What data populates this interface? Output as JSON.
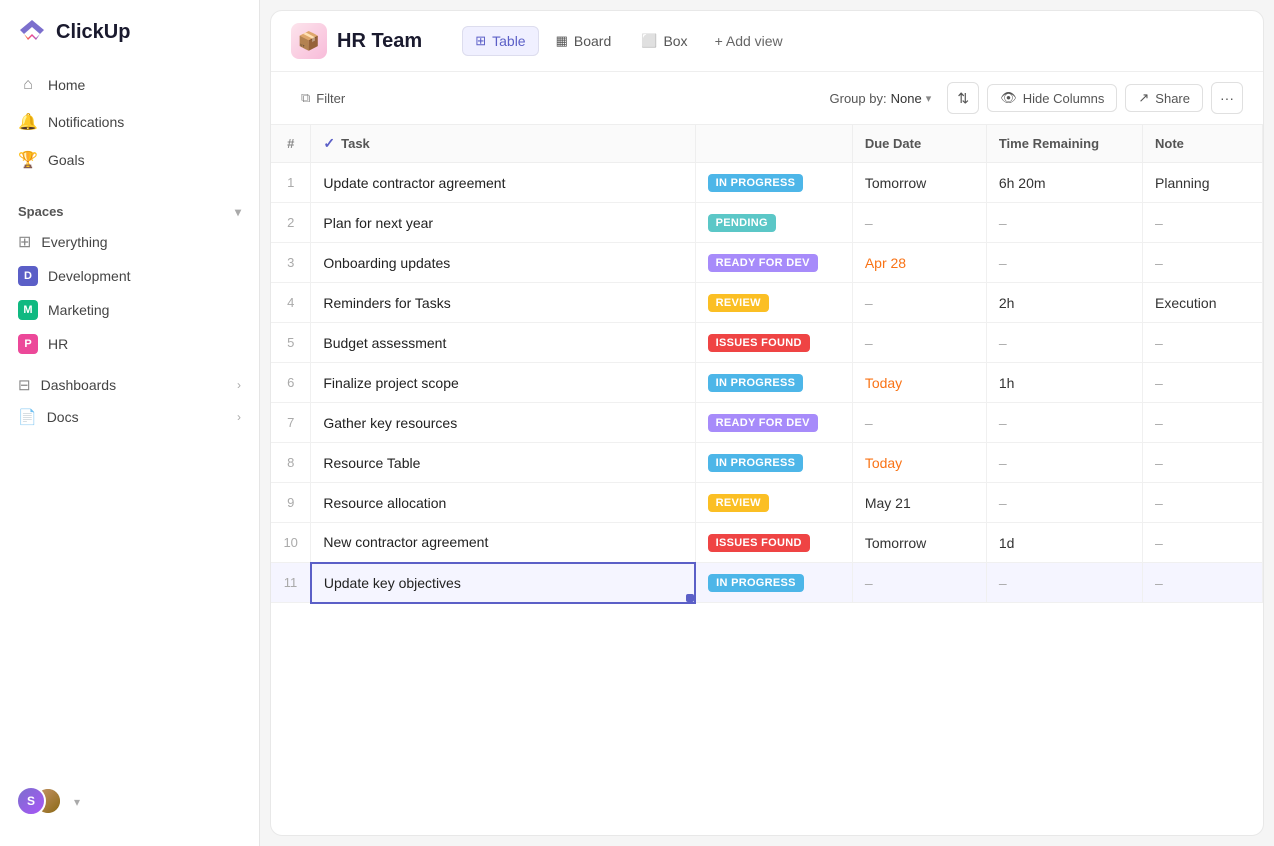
{
  "app": {
    "name": "ClickUp"
  },
  "sidebar": {
    "nav": [
      {
        "id": "home",
        "label": "Home",
        "icon": "⌂"
      },
      {
        "id": "notifications",
        "label": "Notifications",
        "icon": "🔔"
      },
      {
        "id": "goals",
        "label": "Goals",
        "icon": "🏆"
      }
    ],
    "spaces_label": "Spaces",
    "everything_label": "Everything",
    "spaces": [
      {
        "id": "development",
        "label": "Development",
        "initial": "D",
        "color": "#5b5fc7"
      },
      {
        "id": "marketing",
        "label": "Marketing",
        "initial": "M",
        "color": "#10b981"
      },
      {
        "id": "hr",
        "label": "HR",
        "initial": "P",
        "color": "#ec4899"
      }
    ],
    "dashboards_label": "Dashboards",
    "docs_label": "Docs"
  },
  "header": {
    "space_name": "HR Team",
    "views": [
      {
        "id": "table",
        "label": "Table",
        "active": true
      },
      {
        "id": "board",
        "label": "Board",
        "active": false
      },
      {
        "id": "box",
        "label": "Box",
        "active": false
      }
    ],
    "add_view_label": "+ Add view"
  },
  "toolbar": {
    "filter_label": "Filter",
    "groupby_label": "Group by:",
    "groupby_value": "None",
    "hide_columns_label": "Hide Columns",
    "share_label": "Share"
  },
  "table": {
    "columns": [
      "#",
      "Task",
      "",
      "Due Date",
      "Time Remaining",
      "Note"
    ],
    "rows": [
      {
        "num": 1,
        "task": "Update contractor agreement",
        "status": "IN PROGRESS",
        "status_class": "status-in-progress",
        "due_date": "Tomorrow",
        "due_class": "due-date-normal",
        "time_remaining": "6h 20m",
        "note": "Planning"
      },
      {
        "num": 2,
        "task": "Plan for next year",
        "status": "PENDING",
        "status_class": "status-pending",
        "due_date": "–",
        "due_class": "due-date-dash",
        "time_remaining": "–",
        "note": "–"
      },
      {
        "num": 3,
        "task": "Onboarding updates",
        "status": "READY FOR DEV",
        "status_class": "status-ready-for-dev",
        "due_date": "Apr 28",
        "due_class": "due-date-apr",
        "time_remaining": "–",
        "note": "–"
      },
      {
        "num": 4,
        "task": "Reminders for Tasks",
        "status": "REVIEW",
        "status_class": "status-review",
        "due_date": "–",
        "due_class": "due-date-dash",
        "time_remaining": "2h",
        "note": "Execution"
      },
      {
        "num": 5,
        "task": "Budget assessment",
        "status": "ISSUES FOUND",
        "status_class": "status-issues-found",
        "due_date": "–",
        "due_class": "due-date-dash",
        "time_remaining": "–",
        "note": "–"
      },
      {
        "num": 6,
        "task": "Finalize project scope",
        "status": "IN PROGRESS",
        "status_class": "status-in-progress",
        "due_date": "Today",
        "due_class": "due-date-today",
        "time_remaining": "1h",
        "note": "–"
      },
      {
        "num": 7,
        "task": "Gather key resources",
        "status": "READY FOR DEV",
        "status_class": "status-ready-for-dev",
        "due_date": "–",
        "due_class": "due-date-dash",
        "time_remaining": "–",
        "note": "–"
      },
      {
        "num": 8,
        "task": "Resource Table",
        "status": "IN PROGRESS",
        "status_class": "status-in-progress",
        "due_date": "Today",
        "due_class": "due-date-today",
        "time_remaining": "–",
        "note": "–"
      },
      {
        "num": 9,
        "task": "Resource allocation",
        "status": "REVIEW",
        "status_class": "status-review",
        "due_date": "May 21",
        "due_class": "due-date-normal",
        "time_remaining": "–",
        "note": "–"
      },
      {
        "num": 10,
        "task": "New contractor agreement",
        "status": "ISSUES FOUND",
        "status_class": "status-issues-found",
        "due_date": "Tomorrow",
        "due_class": "due-date-normal",
        "time_remaining": "1d",
        "note": "–"
      },
      {
        "num": 11,
        "task": "Update key objectives",
        "status": "IN PROGRESS",
        "status_class": "status-in-progress",
        "due_date": "–",
        "due_class": "due-date-dash",
        "time_remaining": "–",
        "note": "–",
        "selected": true
      }
    ]
  }
}
